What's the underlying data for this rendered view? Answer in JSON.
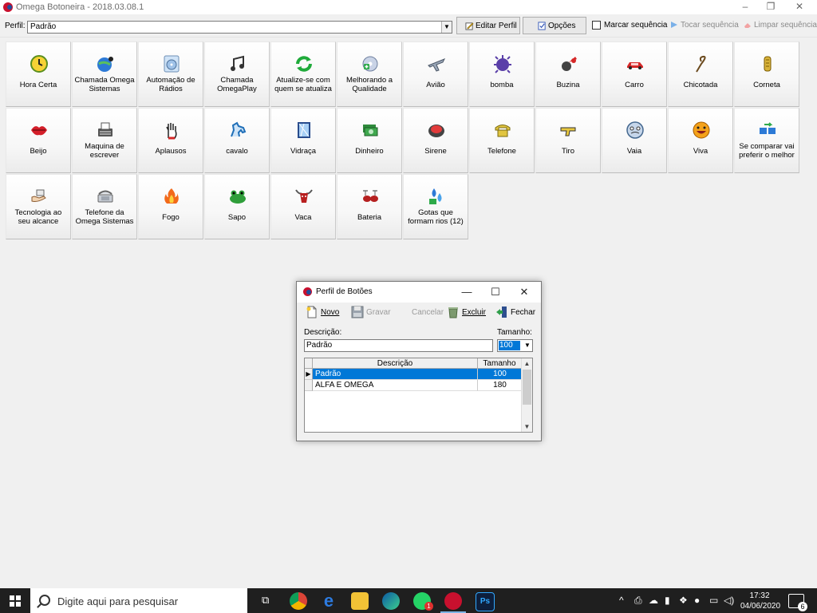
{
  "window": {
    "title": "Omega Botoneira - 2018.03.08.1",
    "minimize": "–",
    "restore": "❐",
    "close": "✕"
  },
  "toolbar": {
    "perfil_label": "Perfil:",
    "perfil_value": "Padrão",
    "editar_label": "Editar Perfil",
    "opcoes_label": "Opções",
    "marcar_label": "Marcar sequência",
    "tocar_label": "Tocar sequência",
    "limpar_label": "Limpar sequência"
  },
  "buttons": [
    [
      {
        "label": "Hora Certa",
        "icon": "clock-icon"
      },
      {
        "label": "Chamada Omega Sistemas",
        "icon": "globe-music-icon"
      },
      {
        "label": "Automação de Rádios",
        "icon": "cd-icon"
      },
      {
        "label": "Chamada OmegaPlay",
        "icon": "music-notes-icon"
      },
      {
        "label": "Atualize-se com quem se atualiza",
        "icon": "refresh-icon"
      },
      {
        "label": "Melhorando a Qualidade",
        "icon": "disc-plus-icon"
      },
      {
        "label": "Avião",
        "icon": "airplane-icon"
      },
      {
        "label": "bomba",
        "icon": "bomb-icon"
      },
      {
        "label": "Buzina",
        "icon": "horn-icon"
      },
      {
        "label": "Carro",
        "icon": "car-icon"
      },
      {
        "label": "Chicotada",
        "icon": "whip-icon"
      },
      {
        "label": "Corneta",
        "icon": "trumpet-icon"
      }
    ],
    [
      {
        "label": "Beijo",
        "icon": "lips-icon"
      },
      {
        "label": "Maquina de escrever",
        "icon": "typewriter-icon"
      },
      {
        "label": "Aplausos",
        "icon": "hand-icon"
      },
      {
        "label": "cavalo",
        "icon": "horse-icon"
      },
      {
        "label": "Vidraça",
        "icon": "window-icon"
      },
      {
        "label": "Dinheiro",
        "icon": "money-icon"
      },
      {
        "label": "Sirene",
        "icon": "siren-icon"
      },
      {
        "label": "Telefone",
        "icon": "telephone-icon"
      },
      {
        "label": "Tiro",
        "icon": "gun-icon"
      },
      {
        "label": "Vaia",
        "icon": "boo-face-icon"
      },
      {
        "label": "Viva",
        "icon": "smiley-icon"
      },
      {
        "label": "Se comparar vai preferir o melhor",
        "icon": "compare-computers-icon"
      }
    ],
    [
      {
        "label": "Tecnologia ao seu alcance",
        "icon": "tech-hand-icon"
      },
      {
        "label": "Telefone da Omega Sistemas",
        "icon": "office-phone-icon"
      },
      {
        "label": "Fogo",
        "icon": "fire-icon"
      },
      {
        "label": "Sapo",
        "icon": "frog-icon"
      },
      {
        "label": "Vaca",
        "icon": "bull-icon"
      },
      {
        "label": "Bateria",
        "icon": "drums-icon"
      },
      {
        "label": "Gotas que formam rios (12)",
        "icon": "water-drops-icon"
      }
    ]
  ],
  "dialog": {
    "title": "Perfil de Botões",
    "minimize": "—",
    "maximize": "☐",
    "close": "✕",
    "novo": "Novo",
    "gravar": "Gravar",
    "cancelar": "Cancelar",
    "excluir": "Excluir",
    "fechar": "Fechar",
    "descricao_label": "Descrição:",
    "descricao_value": "Padrão",
    "tamanho_label": "Tamanho:",
    "tamanho_value": "100",
    "table": {
      "columns": [
        "Descrição",
        "Tamanho"
      ],
      "rows": [
        {
          "descricao": "Padrão",
          "tamanho": "100",
          "selected": true
        },
        {
          "descricao": "ALFA E OMEGA",
          "tamanho": "180",
          "selected": false
        }
      ]
    }
  },
  "taskbar": {
    "search_placeholder": "Digite aqui para pesquisar",
    "time": "17:32",
    "date": "04/06/2020",
    "notifications": "6",
    "whatsapp_badge": "1",
    "photoshop_label": "Ps"
  },
  "colors": {
    "selection": "#0078d7",
    "logo_red": "#c8102e",
    "logo_blue": "#1f4e9c"
  }
}
